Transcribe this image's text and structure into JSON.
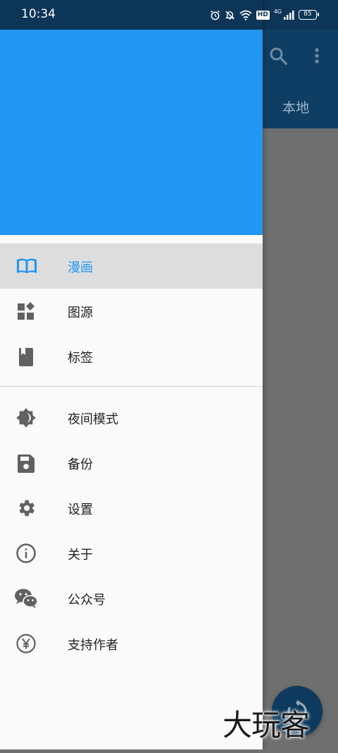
{
  "status_bar": {
    "time": "10:34",
    "hd": "HD",
    "network": "4G",
    "battery": "85"
  },
  "background": {
    "tab_label": "本地",
    "appbar_color": "#0f3e64",
    "icons": [
      "search-icon",
      "more-vertical-icon"
    ]
  },
  "drawer": {
    "header_color": "#2196f3",
    "accent_color": "#2196f3",
    "primary_items": [
      {
        "label": "漫画",
        "icon": "book-open-icon",
        "active": true
      },
      {
        "label": "图源",
        "icon": "dashboard-widgets-icon"
      },
      {
        "label": "标签",
        "icon": "bookmark-book-icon"
      }
    ],
    "secondary_items": [
      {
        "label": "夜间模式",
        "icon": "brightness-icon"
      },
      {
        "label": "备份",
        "icon": "save-icon"
      },
      {
        "label": "设置",
        "icon": "gear-icon"
      },
      {
        "label": "关于",
        "icon": "info-icon"
      },
      {
        "label": "公众号",
        "icon": "wechat-icon"
      },
      {
        "label": "支持作者",
        "icon": "yen-coin-icon"
      }
    ]
  },
  "watermark": {
    "text": "大玩客"
  }
}
